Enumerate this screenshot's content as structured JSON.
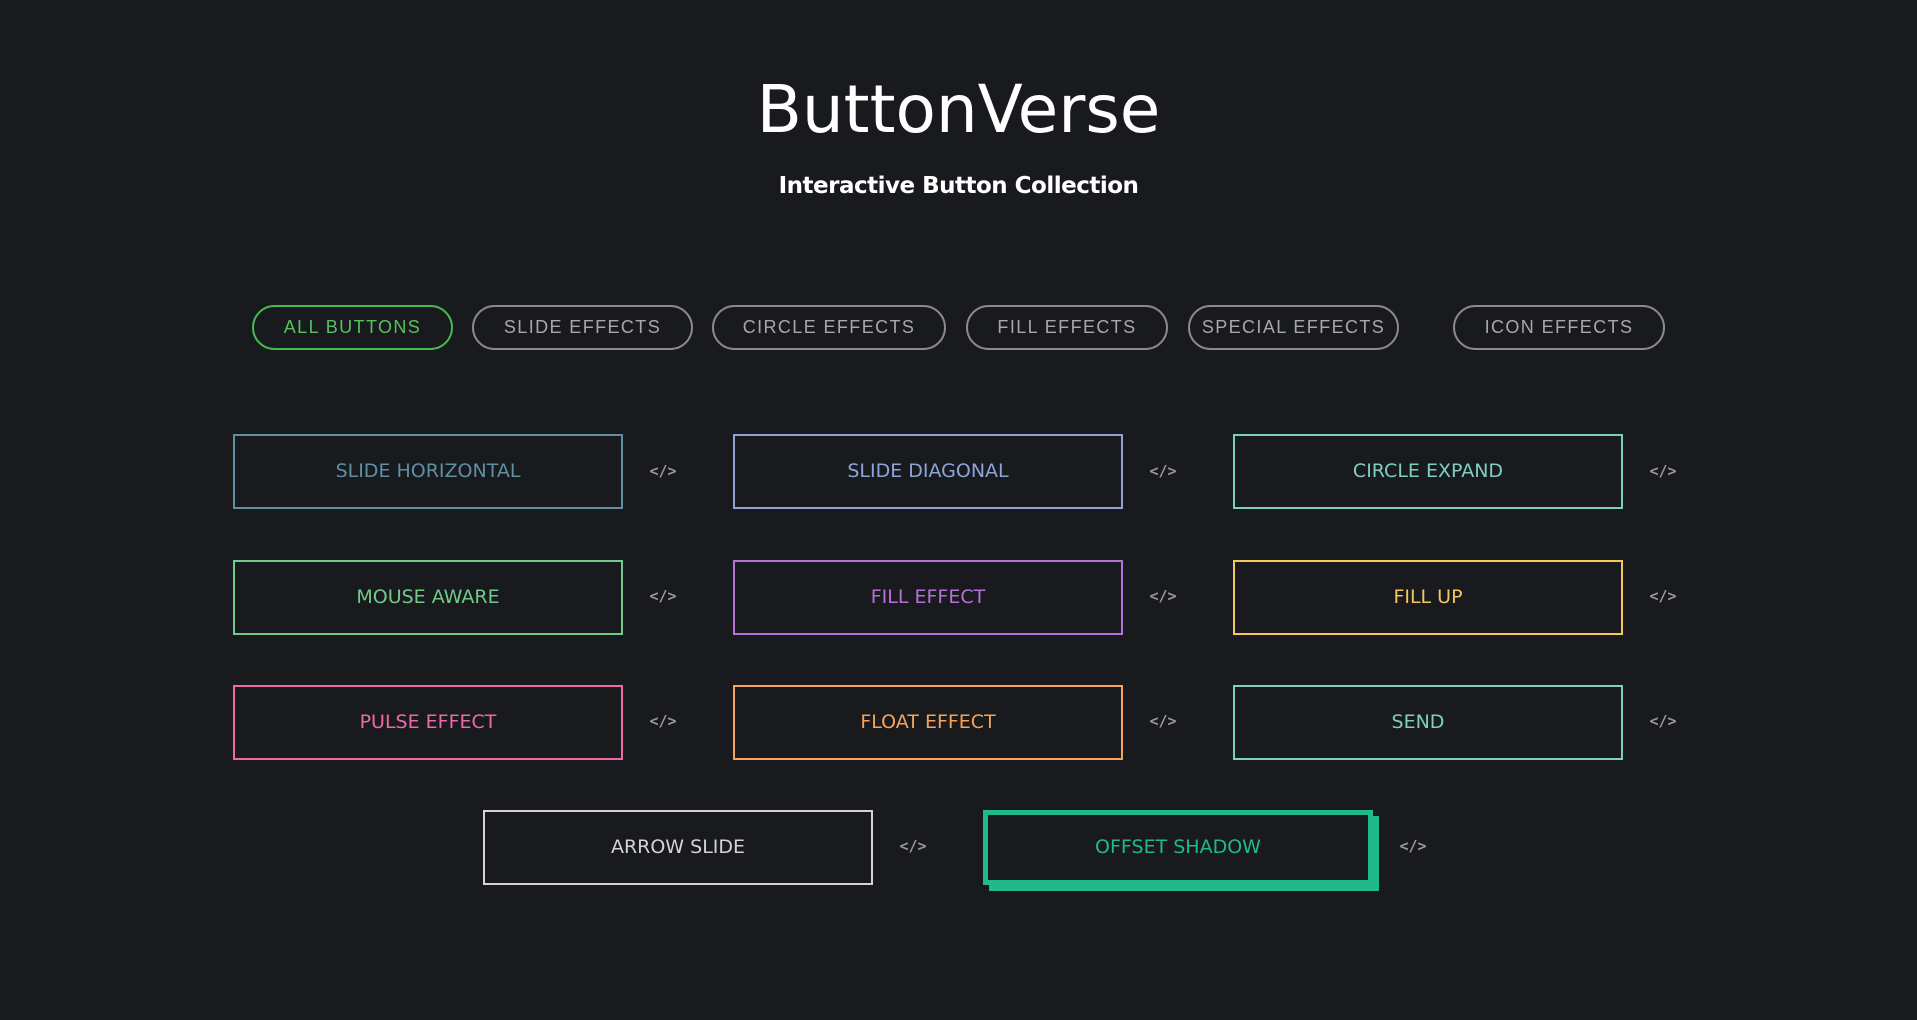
{
  "header": {
    "title": "ButtonVerse",
    "subtitle": "Interactive Button Collection"
  },
  "filters": [
    {
      "label": "ALL BUTTONS",
      "active": true
    },
    {
      "label": "SLIDE EFFECTS",
      "active": false
    },
    {
      "label": "CIRCLE EFFECTS",
      "active": false
    },
    {
      "label": "FILL EFFECTS",
      "active": false
    },
    {
      "label": "SPECIAL EFFECTS",
      "active": false
    },
    {
      "label": "ICON EFFECTS",
      "active": false
    }
  ],
  "code_icon": "</>",
  "buttons": [
    {
      "label": "SLIDE HORIZONTAL",
      "color": "#5f8fa3"
    },
    {
      "label": "SLIDE DIAGONAL",
      "color": "#8ea3d8"
    },
    {
      "label": "CIRCLE EXPAND",
      "color": "#7fcfbf"
    },
    {
      "label": "MOUSE AWARE",
      "color": "#72c98c"
    },
    {
      "label": "FILL EFFECT",
      "color": "#b671d8"
    },
    {
      "label": "FILL UP",
      "color": "#f2c85b"
    },
    {
      "label": "PULSE EFFECT",
      "color": "#ee6aa7"
    },
    {
      "label": "FLOAT EFFECT",
      "color": "#f5a35b"
    },
    {
      "label": "SEND",
      "color": "#7fcfbf"
    },
    {
      "label": "ARROW SLIDE",
      "color": "#d4d4d4"
    },
    {
      "label": "OFFSET SHADOW",
      "color": "#1fb98a"
    }
  ],
  "colors": {
    "background": "#191a1e",
    "active_filter": "#45b84f",
    "inactive_filter": "#8a8a8a"
  }
}
